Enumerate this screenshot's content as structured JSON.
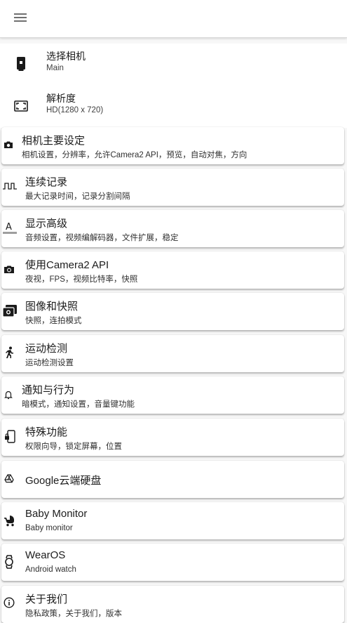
{
  "menu": {
    "icon": "hamburger-menu-icon"
  },
  "camera_select": {
    "title": "选择相机",
    "value": "Main",
    "icon": "phone-camera-icon"
  },
  "resolution": {
    "title": "解析度",
    "value": "HD(1280 x 720)",
    "icon": "fullscreen-frame-icon"
  },
  "settings": [
    {
      "title": "相机主要设定",
      "subtitle": "相机设置，分辨率，允许Camera2 API，预览，自动对焦，方向",
      "icon": "camera-icon"
    },
    {
      "title": "连续记录",
      "subtitle": "最大记录时间，记录分割间隔",
      "icon": "square-wave-icon"
    },
    {
      "title": "显示高级",
      "subtitle": "音频设置，视频编解码器，文件扩展，稳定",
      "icon": "text-format-icon"
    },
    {
      "title": "使用Camera2 API",
      "subtitle": "夜视，FPS，视频比特率，快照",
      "icon": "camera-switch-icon"
    },
    {
      "title": "图像和快照",
      "subtitle": "快照，连拍模式",
      "icon": "burst-photo-icon"
    },
    {
      "title": "运动检测",
      "subtitle": "运动检测设置",
      "icon": "running-person-icon"
    },
    {
      "title": "通知与行为",
      "subtitle": "暗模式，通知设置，音量键功能",
      "icon": "bell-icon"
    },
    {
      "title": "特殊功能",
      "subtitle": "权限向导，锁定屏幕，位置",
      "icon": "phone-lock-icon"
    },
    {
      "title": "Google云端硬盘",
      "subtitle": "",
      "icon": "google-drive-icon"
    },
    {
      "title": "Baby Monitor",
      "subtitle": "Baby monitor",
      "icon": "stroller-icon"
    },
    {
      "title": "WearOS",
      "subtitle": "Android watch",
      "icon": "watch-icon"
    },
    {
      "title": "关于我们",
      "subtitle": "隐私政策，关于我们，版本",
      "icon": "info-icon"
    }
  ]
}
